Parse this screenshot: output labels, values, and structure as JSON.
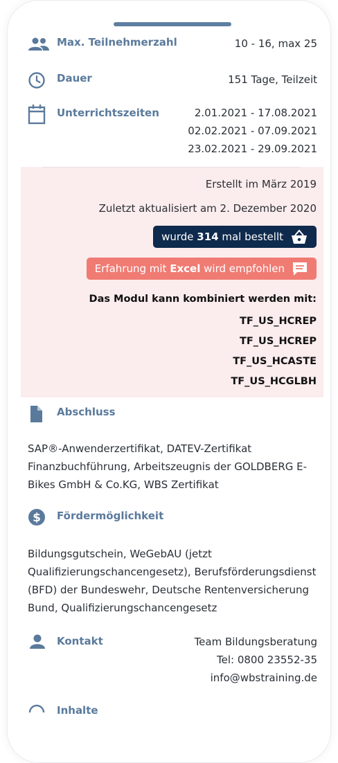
{
  "details": {
    "participants": {
      "label": "Max. Teilnehmerzahl",
      "value": "10 - 16, max 25"
    },
    "duration": {
      "label": "Dauer",
      "value": "151 Tage,  Teilzeit"
    },
    "schedule": {
      "label": "Unterrichtszeiten",
      "dates": [
        "2.01.2021 - 17.08.2021",
        "02.02.2021 - 07.09.2021",
        "23.02.2021 - 29.09.2021"
      ]
    }
  },
  "info": {
    "created": "Erstellt im März 2019",
    "updated": "Zuletzt aktualisiert am 2. Dezember 2020",
    "ordered": {
      "prefix": "wurde ",
      "count": "314",
      "suffix": " mal bestellt"
    },
    "experience": {
      "prefix": "Erfahrung mit ",
      "skill": "Excel",
      "suffix": " wird empfohlen"
    },
    "combine_heading": "Das Modul kann kombiniert werden mit:",
    "modules": [
      "TF_US_HCREP",
      "TF_US_HCREP",
      "TF_US_HCASTE",
      "TF_US_HCGLBH"
    ]
  },
  "abschluss": {
    "label": "Abschluss",
    "text": "SAP®-Anwenderzertifikat, DATEV-Zertifikat Finanzbuchführung, Arbeitszeugnis der GOLDBERG E-Bikes GmbH & Co.KG, WBS Zertifikat"
  },
  "foerderung": {
    "label": "Fördermöglichkeit",
    "text": "Bildungsgutschein, WeGebAU (jetzt Qualifizierungschancengesetz), Berufsförderungsdienst (BFD) der Bundeswehr, Deutsche Rentenversicherung Bund, Qualifizierungschancengesetz"
  },
  "kontakt": {
    "label": "Kontakt",
    "lines": [
      "Team Bildungsberatung",
      "Tel: 0800 23552-35",
      "info@wbstraining.de"
    ]
  },
  "inhalte": {
    "label": "Inhalte"
  },
  "colors": {
    "label": "#5a7a9c",
    "highlight_bg": "#fbeced",
    "dark_badge": "#0e2a4d",
    "coral_badge": "#f07b73"
  }
}
